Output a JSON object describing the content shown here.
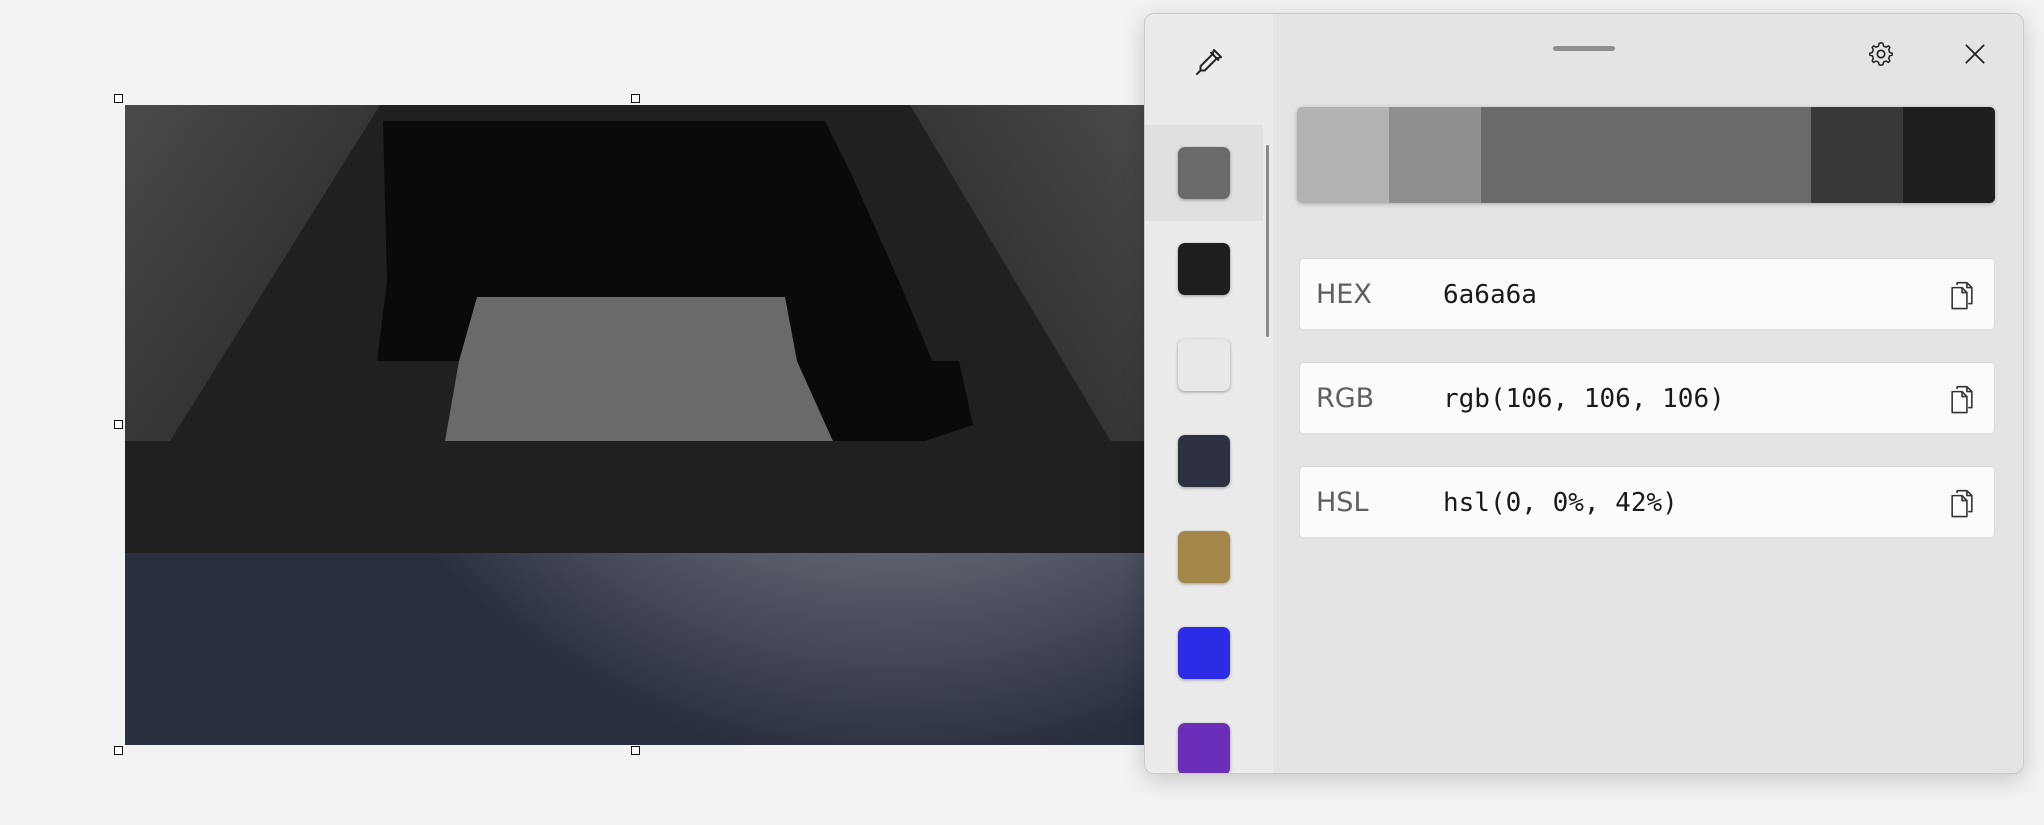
{
  "preview": {
    "alt": "zoomed screen preview",
    "colors": {
      "dark_top": "#202020",
      "black": "#0a0a0a",
      "mid_gray": "#6a6a6a",
      "gradient_dark": "#2a2f40",
      "gradient_light": "#f6f6f6"
    }
  },
  "toolbar": {
    "picker_icon": "eyedropper-icon",
    "settings_icon": "gear-icon",
    "close_icon": "close-icon"
  },
  "history": {
    "selected_index": 0,
    "colors": [
      "#6a6a6a",
      "#1e1e1e",
      "#e8e8e6",
      "#2d3142",
      "#a6874a",
      "#2c2ce6",
      "#6a2eb8"
    ]
  },
  "shades": {
    "colors": [
      "#b3b3b3",
      "#8f8f8f",
      "#6a6a6a",
      "#6a6a6a",
      "#383838",
      "#1f1f1f"
    ],
    "weights": [
      1,
      1,
      1.8,
      1.8,
      1,
      1
    ]
  },
  "fields": [
    {
      "label": "HEX",
      "value": "6a6a6a",
      "copy_icon": "copy-icon"
    },
    {
      "label": "RGB",
      "value": "rgb(106, 106, 106)",
      "copy_icon": "copy-icon"
    },
    {
      "label": "HSL",
      "value": "hsl(0, 0%, 42%)",
      "copy_icon": "copy-icon"
    }
  ]
}
